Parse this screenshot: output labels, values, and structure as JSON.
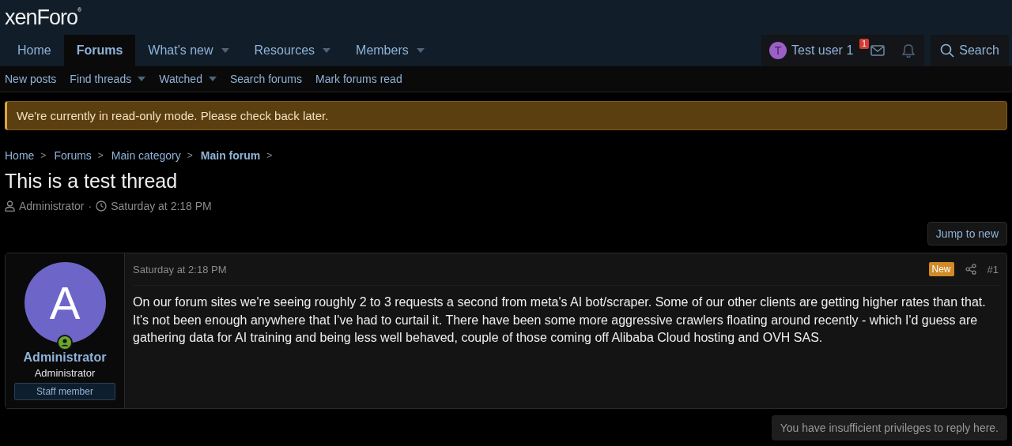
{
  "logo": {
    "text": "xenForo",
    "mark": "®"
  },
  "nav": {
    "tabs": [
      {
        "label": "Home",
        "selected": false,
        "has_menu": false
      },
      {
        "label": "Forums",
        "selected": true,
        "has_menu": false
      },
      {
        "label": "What's new",
        "selected": false,
        "has_menu": true
      },
      {
        "label": "Resources",
        "selected": false,
        "has_menu": true
      },
      {
        "label": "Members",
        "selected": false,
        "has_menu": true
      }
    ],
    "user": {
      "initial": "T",
      "name": "Test user 1"
    },
    "inbox_badge": "1",
    "search": "Search"
  },
  "subnav": [
    {
      "label": "New posts",
      "has_menu": false
    },
    {
      "label": "Find threads",
      "has_menu": true
    },
    {
      "label": "Watched",
      "has_menu": true
    },
    {
      "label": "Search forums",
      "has_menu": false
    },
    {
      "label": "Mark forums read",
      "has_menu": false
    }
  ],
  "notice": "We're currently in read-only mode. Please check back later.",
  "breadcrumbs": [
    {
      "label": "Home",
      "current": false
    },
    {
      "label": "Forums",
      "current": false
    },
    {
      "label": "Main category",
      "current": false
    },
    {
      "label": "Main forum",
      "current": true
    }
  ],
  "breadcrumb_separator": ">",
  "thread": {
    "title": "This is a test thread",
    "author": "Administrator",
    "separator": "·",
    "date": "Saturday at 2:18 PM"
  },
  "jump_button": "Jump to new",
  "post": {
    "avatar_letter": "A",
    "online": true,
    "username": "Administrator",
    "user_title": "Administrator",
    "banner": "Staff member",
    "date": "Saturday at 2:18 PM",
    "new_badge": "New",
    "number": "#1",
    "body": "On our forum sites we're seeing roughly 2 to 3 requests a second from meta's AI bot/scraper. Some of our other clients are getting higher rates than that. It's not been enough anywhere that I've had to curtail it. There have been some more aggressive crawlers floating around recently - which I'd guess are gathering data for AI training and being less well behaved, couple of those coming off Alibaba Cloud hosting and OVH SAS."
  },
  "reply_notice": "You have insufficient privileges to reply here."
}
